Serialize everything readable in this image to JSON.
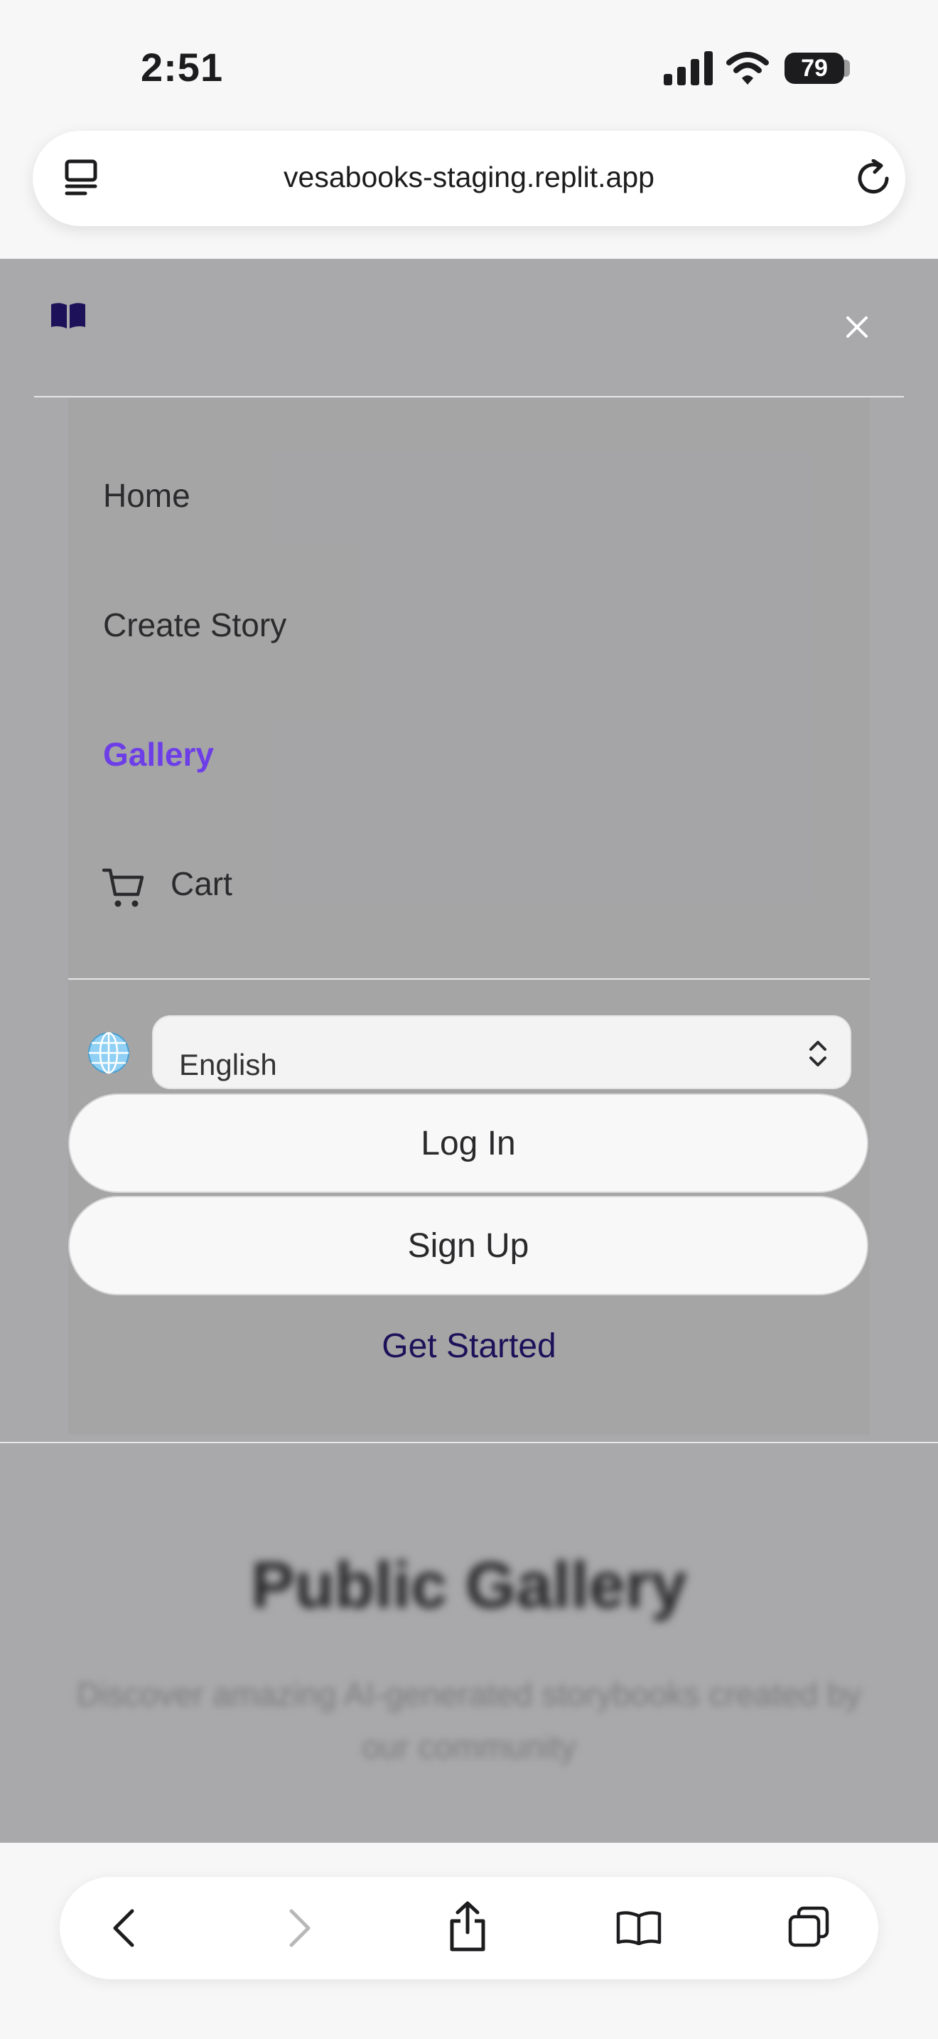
{
  "status_bar": {
    "time": "2:51",
    "battery": "79",
    "icons": [
      "cellular-signal-icon",
      "wifi-icon",
      "battery-icon"
    ]
  },
  "browser": {
    "url": "vesabooks-staging.replit.app",
    "left_icon": "reader-mode-icon",
    "right_icon": "reload-icon",
    "toolbar_icons": [
      "back-icon",
      "forward-icon",
      "share-icon",
      "bookmarks-icon",
      "tabs-icon"
    ]
  },
  "menu": {
    "logo_icon": "open-book-icon",
    "close_icon": "close-icon",
    "items": [
      {
        "label": "Home",
        "active": false
      },
      {
        "label": "Create Story",
        "active": false
      },
      {
        "label": "Gallery",
        "active": true
      },
      {
        "label": "Cart",
        "active": false,
        "icon": "cart-icon"
      }
    ],
    "language": {
      "icon": "globe-icon",
      "selected": "English"
    },
    "login_label": "Log In",
    "signup_label": "Sign Up",
    "get_started_label": "Get Started"
  },
  "page": {
    "title": "Public Gallery",
    "subtitle": "Discover amazing AI-generated storybooks created by our community"
  },
  "colors": {
    "overlay": "#a9a9ab",
    "active_nav": "#6d3ee8",
    "logo": "#1d1159",
    "get_started": "#1d1159"
  }
}
